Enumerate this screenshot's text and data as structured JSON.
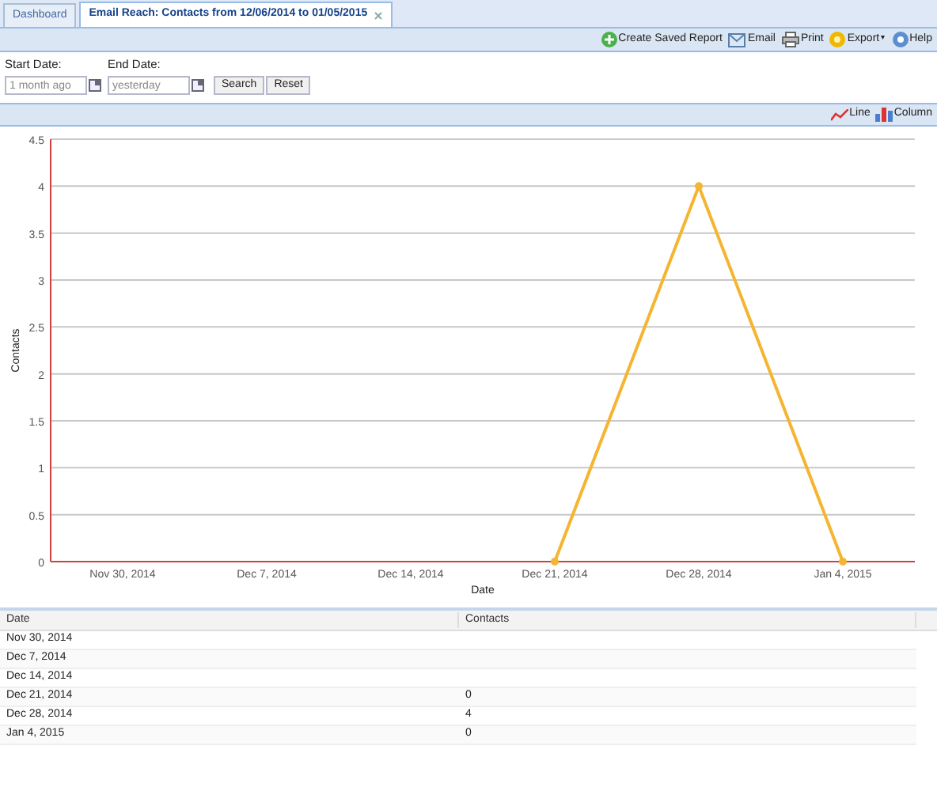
{
  "tabs": [
    {
      "label": "Dashboard",
      "selected": false,
      "closable": false
    },
    {
      "label": "Email Reach: Contacts from 12/06/2014 to 01/05/2015",
      "selected": true,
      "closable": true
    }
  ],
  "toolbar": [
    {
      "kind": "add",
      "label": "Create Saved Report"
    },
    {
      "kind": "email",
      "label": "Email"
    },
    {
      "kind": "print",
      "label": "Print"
    },
    {
      "kind": "export",
      "label": "Export",
      "caret": "▾"
    },
    {
      "kind": "help",
      "label": "Help"
    }
  ],
  "filters": [
    {
      "label": "Start Date:",
      "placeholder": "1 month ago"
    },
    {
      "label": "End Date:",
      "placeholder": "yesterday"
    }
  ],
  "filter_buttons": [
    "Search",
    "Reset"
  ],
  "chart_types": [
    {
      "kind": "line",
      "label": "Line"
    },
    {
      "kind": "column",
      "label": "Column"
    }
  ],
  "chart_data": {
    "type": "line",
    "xlabel": "Date",
    "ylabel": "Contacts",
    "categories": [
      "Nov 30, 2014",
      "Dec 7, 2014",
      "Dec 14, 2014",
      "Dec 21, 2014",
      "Dec 28, 2014",
      "Jan 4, 2015"
    ],
    "series": [
      {
        "color": "#f5b533",
        "marker": true,
        "values": [
          null,
          null,
          null,
          0,
          4,
          0
        ]
      }
    ],
    "grid": true,
    "ylim": [
      0,
      4.5
    ],
    "yticks": [
      0,
      {
        "value": 0.5,
        "label": "0.5"
      },
      1,
      {
        "value": 1.5,
        "label": "1.5"
      },
      2,
      {
        "value": 2.5,
        "label": "2.5"
      },
      3,
      {
        "value": 3.5,
        "label": "3.5"
      },
      4,
      {
        "value": 4.5,
        "label": "4.5"
      }
    ]
  },
  "table": {
    "columns": [
      "Date",
      "Contacts"
    ],
    "rows": [
      [
        "Nov 30, 2014",
        ""
      ],
      [
        "Dec 7, 2014",
        ""
      ],
      [
        "Dec 14, 2014",
        ""
      ],
      [
        "Dec 21, 2014",
        "0"
      ],
      [
        "Dec 28, 2014",
        "4"
      ],
      [
        "Jan 4, 2015",
        "0"
      ]
    ]
  }
}
